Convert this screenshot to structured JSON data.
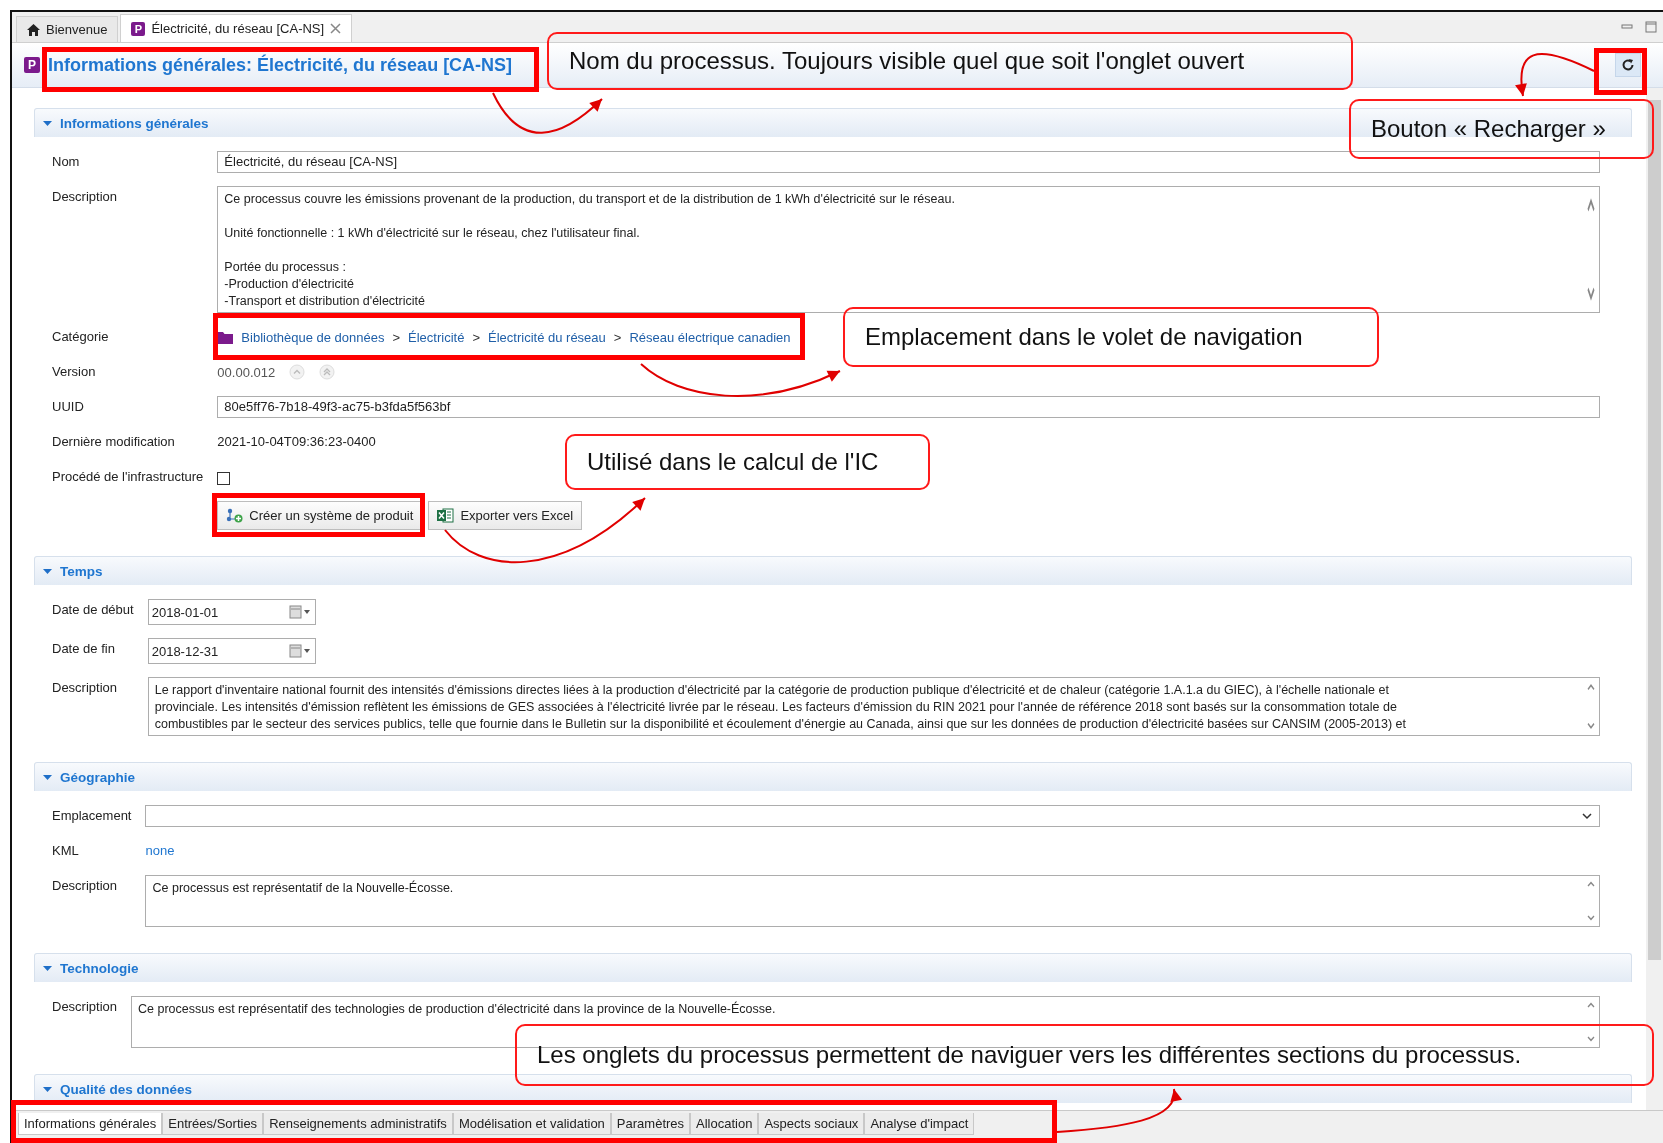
{
  "editor_tabs": [
    {
      "label": "Bienvenue",
      "selected": false,
      "closable": false
    },
    {
      "badge": "P",
      "label": "Électricité, du réseau [CA-NS]",
      "selected": true,
      "closable": true
    }
  ],
  "header": {
    "badge": "P",
    "title": "Informations générales: Électricité, du réseau [CA-NS]"
  },
  "sections": [
    {
      "title": "Informations générales",
      "expanded": true,
      "rows": [
        {
          "kind": "text",
          "label": "Nom",
          "value": "Électricité, du réseau [CA-NS]"
        },
        {
          "kind": "textarea",
          "label": "Description",
          "paragraphs": [
            "Ce processus couvre les émissions provenant de la production, du transport et de la distribution de 1 kWh d'électricité sur le réseau.",
            "Unité fonctionnelle : 1 kWh d'électricité sur le réseau, chez l'utilisateur final.",
            "Portée du processus :\n-Production d'électricité\n-Transport et distribution d'électricité"
          ]
        },
        {
          "kind": "path",
          "label": "Catégorie",
          "items": [
            {
              "label": "Bibliothèque de données"
            },
            {
              "prefix": ">",
              "label": "Électricité"
            },
            {
              "prefix": ">",
              "label": "Électricité du réseau"
            },
            {
              "prefix": ">",
              "label": "Réseau électrique canadien"
            }
          ]
        },
        {
          "kind": "version",
          "label": "Version",
          "value": "00.00.012"
        },
        {
          "kind": "text",
          "label": "UUID",
          "value": "80e5ff76-7b18-49f3-ac75-b3fda5f563bf"
        },
        {
          "kind": "plain",
          "label": "Dernière modification",
          "value": "2021-10-04T09:36:23-0400"
        },
        {
          "kind": "checkbox",
          "label": "Procédé de l'infrastructure",
          "checked": false
        },
        {
          "kind": "buttons",
          "buttons": [
            {
              "kind": "product-system",
              "label": "Créer un système de produit"
            },
            {
              "kind": "excel",
              "label": "Exporter vers Excel"
            }
          ]
        }
      ]
    },
    {
      "title": "Temps",
      "expanded": true,
      "rows": [
        {
          "kind": "date",
          "label": "Date de début",
          "value": "2018-01-01"
        },
        {
          "kind": "date",
          "label": "Date de fin",
          "value": "2018-12-31"
        },
        {
          "kind": "textarea",
          "label": "Description",
          "paragraphs": [
            "Le rapport d'inventaire national fournit des intensités d'émissions directes liées à la production d'électricité par la catégorie de production publique d'électricité et de chaleur (catégorie 1.A.1.a du GIEC), à l'échelle nationale et\nprovinciale. Les intensités d'émission reflètent les émissions de GES associées à l'électricité livrée par le réseau. Les facteurs d'émission du RIN 2021 pour l'année de référence 2018 sont basés sur la consommation totale de\ncombustibles par le secteur des services publics, telle que fournie dans le Bulletin sur la disponibilité et écoulement d'énergie au Canada, ainsi que sur les données de production d'électricité basées sur CANSIM (2005-2013) et"
          ]
        }
      ]
    },
    {
      "title": "Géographie",
      "expanded": true,
      "rows": [
        {
          "kind": "dropdown",
          "label": "Emplacement"
        },
        {
          "kind": "link",
          "label": "KML",
          "value": "none"
        },
        {
          "kind": "textarea",
          "label": "Description",
          "paragraphs": [
            "Ce processus est représentatif de la Nouvelle-Écosse."
          ]
        }
      ]
    },
    {
      "title": "Technologie",
      "expanded": true,
      "rows": [
        {
          "kind": "textarea",
          "label": "Description",
          "paragraphs": [
            "Ce processus est représentatif des technologies de production d'électricité dans la province de la Nouvelle-Écosse."
          ]
        }
      ]
    },
    {
      "title": "Qualité des données",
      "expanded": true
    }
  ],
  "bottom_tabs": [
    {
      "label": "Informations générales",
      "selected": true
    },
    {
      "label": "Entrées/Sorties",
      "selected": false
    },
    {
      "label": "Renseignements administratifs",
      "selected": false
    },
    {
      "label": "Modélisation et validation",
      "selected": false
    },
    {
      "label": "Paramètres",
      "selected": false
    },
    {
      "label": "Allocation",
      "selected": false
    },
    {
      "label": "Aspects sociaux",
      "selected": false
    },
    {
      "label": "Analyse d'impact",
      "selected": false
    }
  ],
  "callouts": [
    {
      "text": "Nom du processus. Toujours visible quel que soit l'onglet ouvert"
    },
    {
      "text": "Bouton « Recharger »"
    },
    {
      "text": "Emplacement dans le volet de navigation"
    },
    {
      "text": "Utilisé dans le calcul de l'IC"
    },
    {
      "text": "Les onglets du processus permettent de naviguer vers les différentes sections du processus."
    }
  ]
}
